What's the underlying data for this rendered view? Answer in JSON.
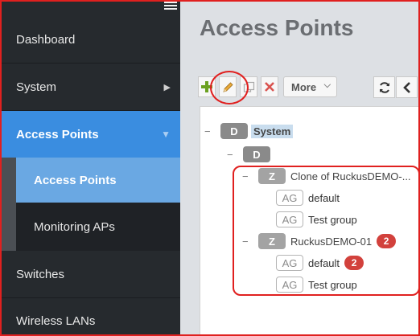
{
  "sidebar": {
    "items": [
      {
        "label": "Dashboard"
      },
      {
        "label": "System"
      },
      {
        "label": "Access Points"
      },
      {
        "label": "Switches"
      },
      {
        "label": "Wireless LANs"
      }
    ],
    "sub_items": [
      {
        "label": "Access Points"
      },
      {
        "label": "Monitoring APs"
      }
    ],
    "arrow_collapsed": "▶",
    "arrow_expanded": "▼"
  },
  "main": {
    "title": "Access Points",
    "toolbar": {
      "more_label": "More",
      "more_chevron": "⌵",
      "icons": [
        "plus-icon",
        "pencil-icon",
        "clone-icon",
        "delete-icon",
        "refresh-icon",
        "chevron-left-icon"
      ]
    },
    "tree": {
      "toggle": "−",
      "system": {
        "badge": "D",
        "label": "System"
      },
      "domain": {
        "badge": "D"
      },
      "zone1": {
        "badge": "Z",
        "label": "Clone of RuckusDEMO-..."
      },
      "zone1_groups": [
        {
          "badge": "AG",
          "label": "default"
        },
        {
          "badge": "AG",
          "label": "Test group"
        }
      ],
      "zone2": {
        "badge": "Z",
        "label": "RuckusDEMO-01",
        "count": "2"
      },
      "zone2_groups": [
        {
          "badge": "AG",
          "label": "default",
          "count": "2"
        },
        {
          "badge": "AG",
          "label": "Test group"
        }
      ]
    }
  },
  "colors": {
    "sidebar_bg": "#262a2e",
    "active_bg": "#3a8de0",
    "sub_active_bg": "#6aa8e3",
    "annotation_red": "#e0201f",
    "count_badge": "#d2413c"
  }
}
